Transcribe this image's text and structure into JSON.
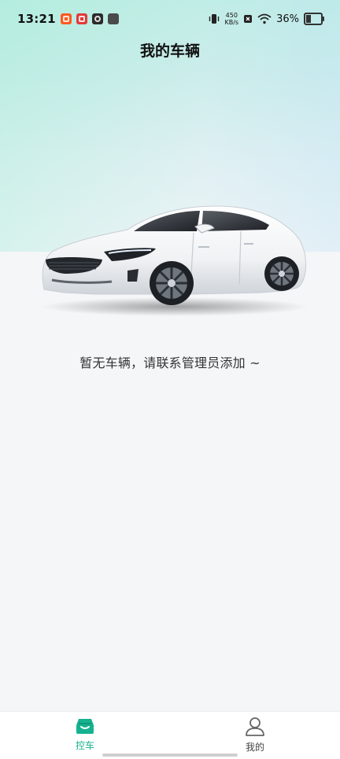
{
  "status_bar": {
    "time": "13:21",
    "net_speed_value": "450",
    "net_speed_unit": "KB/s",
    "battery_percent": "36%",
    "battery_level": 0.36
  },
  "header": {
    "title": "我的车辆"
  },
  "main": {
    "empty_message": "暂无车辆，请联系管理员添加 ~"
  },
  "bottom_nav": {
    "tabs": [
      {
        "label": "控车",
        "icon": "car-icon",
        "active": true
      },
      {
        "label": "我的",
        "icon": "user-icon",
        "active": false
      }
    ],
    "active_color": "#16b28f"
  }
}
